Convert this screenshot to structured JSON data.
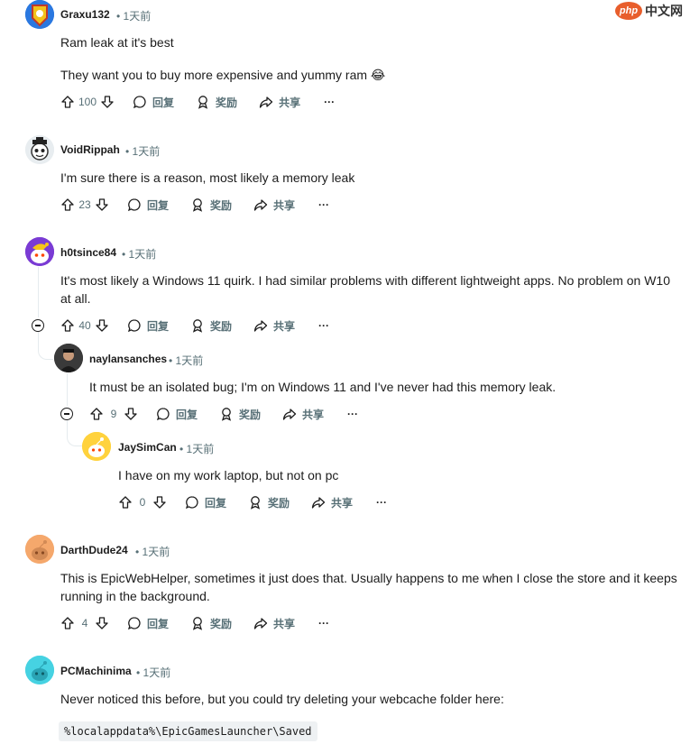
{
  "watermark": {
    "logo": "php",
    "site": "中文网"
  },
  "labels": {
    "reply": "回复",
    "award": "奖励",
    "share": "共享",
    "more": "···",
    "separator": "•"
  },
  "comments": [
    {
      "author": "Graxu132",
      "time": "1天前",
      "lines": [
        "Ram leak at it's best",
        "They want you to buy more expensive and yummy ram 😂"
      ],
      "votes": "100"
    },
    {
      "author": "VoidRippah",
      "time": "1天前",
      "lines": [
        "I'm sure there is a reason, most likely a memory leak"
      ],
      "votes": "23"
    },
    {
      "author": "h0tsince84",
      "time": "1天前",
      "lines": [
        "It's most likely a Windows 11 quirk. I had similar problems with different lightweight apps. No problem on W10 at all."
      ],
      "votes": "40"
    },
    {
      "author": "naylansanches",
      "time": "1天前",
      "lines": [
        "It must be an isolated bug; I'm on Windows 11 and I've never had this memory leak."
      ],
      "votes": "9"
    },
    {
      "author": "JaySimCan",
      "time": "1天前",
      "lines": [
        "I have on my work laptop, but not on pc"
      ],
      "votes": "0"
    },
    {
      "author": "DarthDude24",
      "time": "1天前",
      "lines": [
        "This is EpicWebHelper, sometimes it just does that. Usually happens to me when I close the store and it keeps running in the background."
      ],
      "votes": "4"
    },
    {
      "author": "PCMachinima",
      "time": "1天前",
      "lines": [
        "Never noticed this before, but you could try deleting your webcache folder here:"
      ],
      "code": "%localappdata%\\EpicGamesLauncher\\Saved"
    }
  ]
}
